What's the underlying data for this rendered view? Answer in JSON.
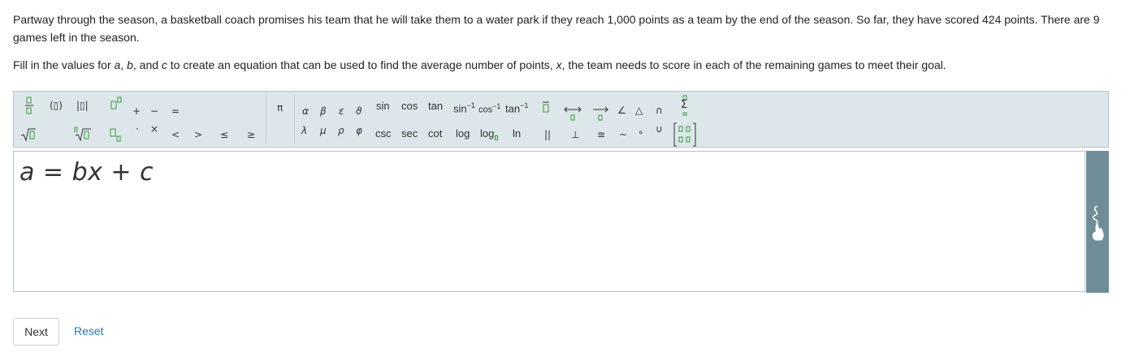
{
  "problem_text": "Partway through the season, a basketball coach promises his team that he will take them to a water park if they reach 1,000 points as a team by the end of the season. So far, they have scored 424 points. There are 9 games left in the season.",
  "instruction": {
    "p1": "Fill in the values for ",
    "a": "a",
    "p2": ", ",
    "b": "b",
    "p3": ", and ",
    "c": "c",
    "p4": " to create an equation that can be used to find the average number of points, ",
    "x": "x",
    "p5": ", the team needs to score in each of the remaining games to meet their goal."
  },
  "toolbar": {
    "paren": "(▯)",
    "abs": "|▯|",
    "plus": "+",
    "minus": "−",
    "equals": "=",
    "cdot": "·",
    "times": "×",
    "lt": "<",
    "gt": ">",
    "le": "≤",
    "ge": "≥",
    "pi": "π",
    "alpha": "α",
    "beta": "β",
    "epsilon": "ε",
    "theta": "ϑ",
    "lambda": "λ",
    "mu": "μ",
    "rho": "ρ",
    "phi": "φ",
    "sin": "sin",
    "cos": "cos",
    "tan": "tan",
    "arcsin": "sin",
    "arccos": "cos",
    "arctan": "tan",
    "inv_exp": "−1",
    "csc": "csc",
    "sec": "sec",
    "cot": "cot",
    "log": "log",
    "log_base": "log",
    "ln": "ln",
    "parallel": "||",
    "perp": "⊥",
    "congruent": "≅",
    "similar": "~",
    "degree": "∘",
    "angle": "∠",
    "triangle": "△",
    "intersect": "∩",
    "union": "∪",
    "sum": "Σ"
  },
  "editor": {
    "expression": "a = bx + c"
  },
  "buttons": {
    "next": "Next",
    "reset": "Reset"
  }
}
